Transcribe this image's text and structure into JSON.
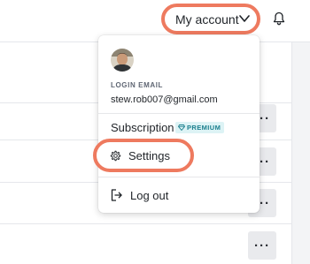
{
  "header": {
    "account_button_label": "My account",
    "chevron_icon": "chevron-down-icon",
    "notification_icon": "bell-icon"
  },
  "account_menu": {
    "avatar_icon": "user-avatar",
    "login_email_label": "LOGIN EMAIL",
    "login_email": "stew.rob007@gmail.com",
    "subscription_label": "Subscription",
    "subscription_badge": "PREMIUM",
    "subscription_badge_icon": "diamond-icon",
    "settings_label": "Settings",
    "settings_icon": "gear-icon",
    "logout_label": "Log out",
    "logout_icon": "logout-icon"
  },
  "rows": [
    {
      "more_icon": "more-horizontal-icon",
      "more_label": "···"
    },
    {
      "more_icon": "more-horizontal-icon",
      "more_label": "···"
    },
    {
      "more_icon": "more-horizontal-icon",
      "more_label": "···"
    },
    {
      "more_icon": "more-horizontal-icon",
      "more_label": "···"
    }
  ],
  "colors": {
    "highlight_ring": "#ee7a5f",
    "premium_badge_bg": "#ddf3f5",
    "premium_badge_text": "#1b7f8e"
  }
}
